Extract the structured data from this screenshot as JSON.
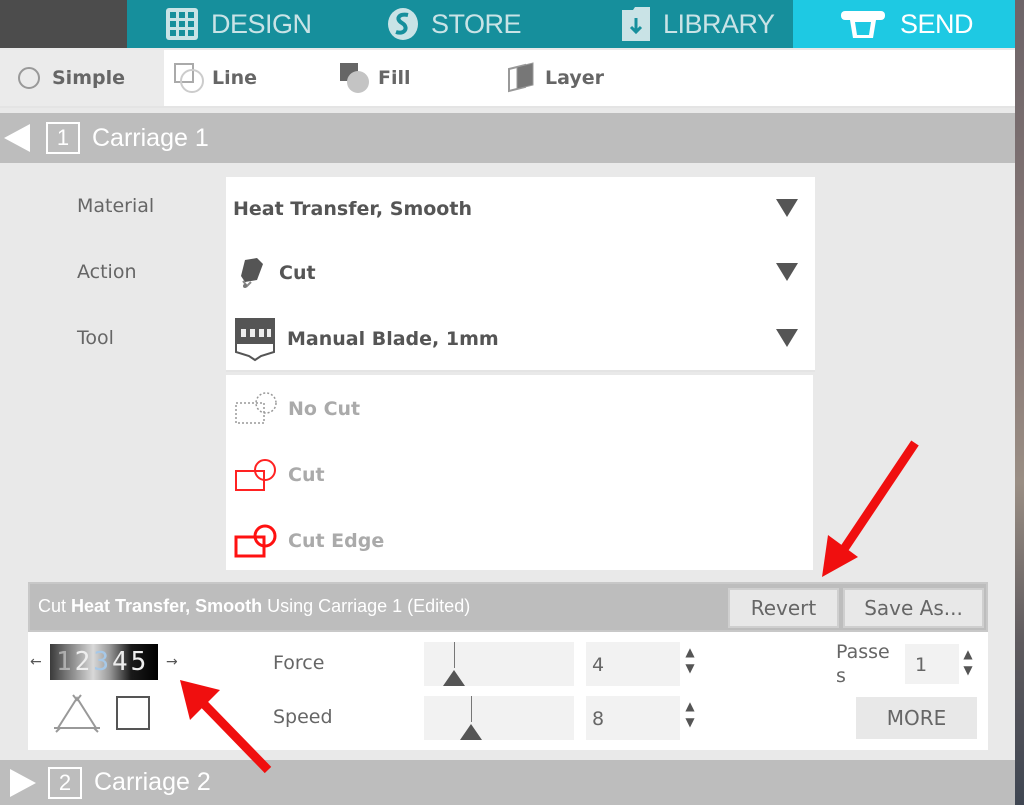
{
  "nav": {
    "items": [
      {
        "label": "DESIGN",
        "icon": "grid-icon"
      },
      {
        "label": "STORE",
        "icon": "silhouette-s-icon"
      },
      {
        "label": "LIBRARY",
        "icon": "download-folder-icon"
      },
      {
        "label": "SEND",
        "icon": "cutter-machine-icon",
        "active": true
      }
    ],
    "colors": {
      "bar": "#168f9c",
      "active": "#1ec9e3"
    }
  },
  "tabs": [
    {
      "label": "Simple",
      "icon": "radio-icon",
      "active": true
    },
    {
      "label": "Line",
      "icon": "line-style-icon"
    },
    {
      "label": "Fill",
      "icon": "fill-style-icon"
    },
    {
      "label": "Layer",
      "icon": "layer-icon"
    }
  ],
  "carriage1": {
    "number": "1",
    "label": "Carriage 1",
    "expanded": true
  },
  "carriage2": {
    "number": "2",
    "label": "Carriage 2",
    "expanded": false
  },
  "fields": {
    "material": {
      "label": "Material",
      "value": "Heat Transfer, Smooth"
    },
    "action": {
      "label": "Action",
      "value": "Cut"
    },
    "tool": {
      "label": "Tool",
      "value": "Manual Blade, 1mm"
    }
  },
  "cut_options": [
    {
      "label": "No Cut",
      "icon": "no-cut-icon"
    },
    {
      "label": "Cut",
      "icon": "cut-icon"
    },
    {
      "label": "Cut Edge",
      "icon": "cut-edge-icon"
    }
  ],
  "settings": {
    "title_prefix": "Cut",
    "title_material": "Heat Transfer, Smooth",
    "title_suffix": "Using Carriage 1 (Edited)",
    "revert_label": "Revert",
    "save_as_label": "Save As...",
    "blade_numbers": [
      "1",
      "2",
      "3",
      "4",
      "5"
    ],
    "force": {
      "label": "Force",
      "value": "4",
      "min": 1,
      "max": 33
    },
    "speed": {
      "label": "Speed",
      "value": "8",
      "min": 1,
      "max": 30
    },
    "passes": {
      "label": "Passes",
      "value": "1"
    },
    "more_label": "MORE"
  },
  "annotation_color": "#f00f0f"
}
